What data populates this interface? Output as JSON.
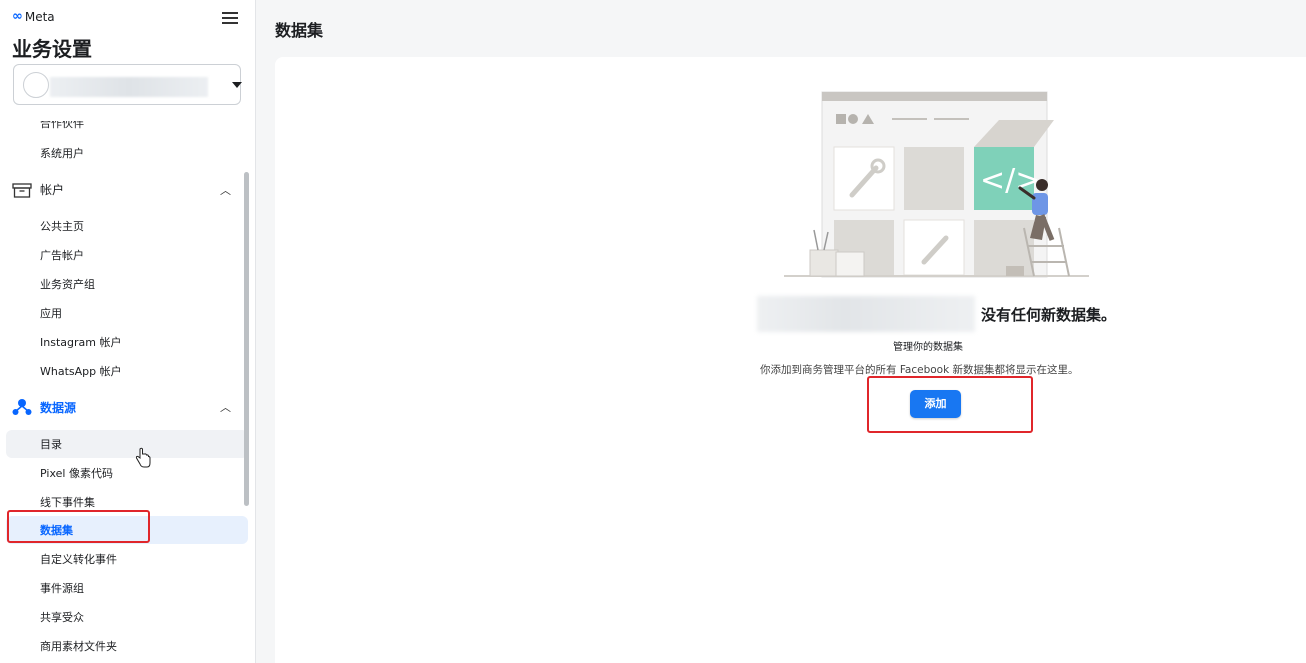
{
  "brand": {
    "logo_text": "Meta"
  },
  "app_title": "业务设置",
  "sidebar": {
    "partial_item": "合作伙伴",
    "system_users": "系统用户",
    "accounts_section": {
      "label": "帐户",
      "expanded": true
    },
    "account_items": [
      "公共主页",
      "广告帐户",
      "业务资产组",
      "应用",
      "Instagram 帐户",
      "WhatsApp 帐户"
    ],
    "datasource_section": {
      "label": "数据源",
      "expanded": true,
      "accent": "#0866ff"
    },
    "datasource_items": [
      "目录",
      "Pixel 像素代码",
      "线下事件集",
      "数据集",
      "自定义转化事件",
      "事件源组",
      "共享受众",
      "商用素材文件夹"
    ],
    "active_item": "数据集"
  },
  "header": {
    "title": "数据集"
  },
  "empty_state": {
    "title": "没有任何新数据集。",
    "subtitle": "管理你的数据集",
    "description": "你添加到商务管理平台的所有 Facebook 新数据集都将显示在这里。",
    "add_button": "添加"
  },
  "colors": {
    "primary": "#1877f2",
    "highlight": "#e0262b",
    "illustration_teal": "#7fd1b9"
  }
}
